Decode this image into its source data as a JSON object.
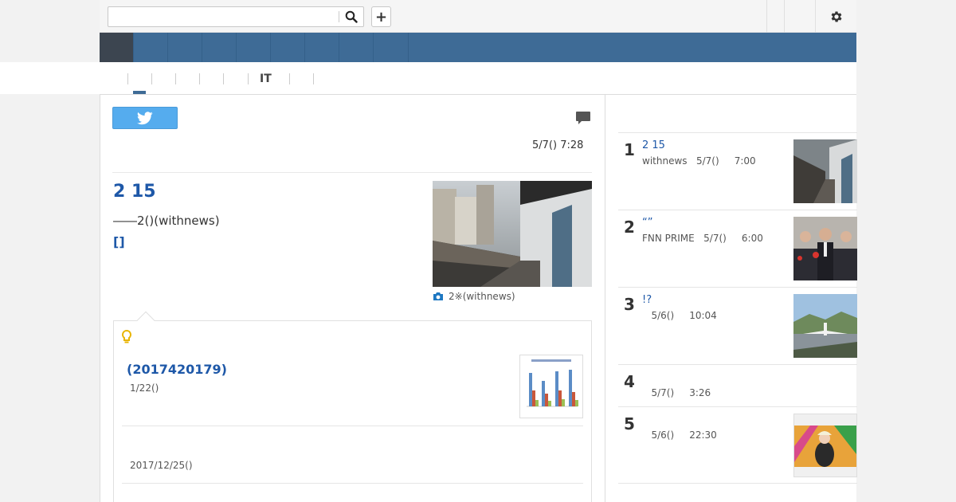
{
  "search": {
    "placeholder": "",
    "value": ""
  },
  "toolbar": {
    "add_label": "+"
  },
  "nav": {
    "category_count": 9,
    "active_index": 0
  },
  "subnav": {
    "items": [
      "",
      "",
      "",
      "",
      "",
      "IT",
      "",
      ""
    ]
  },
  "article": {
    "published": "5/7() 7:28",
    "headline": "2 15",
    "lead": "――2()(withnews)",
    "more_label": "[]",
    "photo_caption": "2※(withnews)"
  },
  "related": {
    "items": [
      {
        "title": "(2017420179)",
        "date": "1/22()"
      },
      {
        "title": "",
        "date": "2017/12/25()"
      }
    ]
  },
  "ranking": [
    {
      "rank": "1",
      "title": "2 15",
      "meta": "withnews   5/7()     7:00"
    },
    {
      "rank": "2",
      "title": "“”",
      "meta": "FNN PRIME   5/7()     6:00"
    },
    {
      "rank": "3",
      "title": "!?",
      "meta": "   5/6()     10:04"
    },
    {
      "rank": "4",
      "title": "",
      "meta": "   5/7()     3:26"
    },
    {
      "rank": "5",
      "title": "",
      "meta": "   5/6()     22:30"
    }
  ],
  "colors": {
    "nav": "#3e6b96",
    "nav_active": "#3c4550",
    "link": "#1e58a8",
    "twitter": "#55acee",
    "bulb": "#e8b400"
  },
  "icons": [
    "search-icon",
    "plus-icon",
    "gear-icon",
    "twitter-icon",
    "comment-icon",
    "camera-icon",
    "lightbulb-icon"
  ]
}
